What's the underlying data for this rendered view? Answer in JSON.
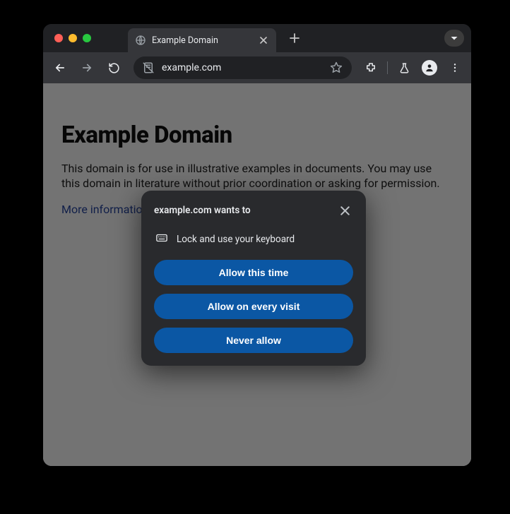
{
  "tabs": {
    "active": {
      "title": "Example Domain"
    }
  },
  "omnibox": {
    "url": "example.com"
  },
  "page": {
    "heading": "Example Domain",
    "paragraph": "This domain is for use in illustrative examples in documents. You may use this domain in literature without prior coordination or asking for permission.",
    "link": "More information..."
  },
  "permission": {
    "title": "example.com wants to",
    "item": "Lock and use your keyboard",
    "allow_this_time": "Allow this time",
    "allow_every_visit": "Allow on every visit",
    "never_allow": "Never allow"
  }
}
